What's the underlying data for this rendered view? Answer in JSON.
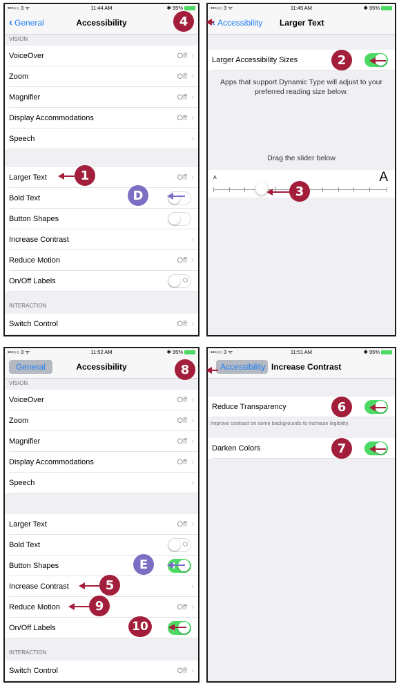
{
  "colors": {
    "accent": "#1a7cf5",
    "toggle_on": "#4cd964",
    "callout_red": "#a31e3a",
    "callout_purple": "#7b6fc4"
  },
  "panel1": {
    "status": {
      "signal": "•••○○ 3 ᯤ",
      "time": "11:44 AM",
      "battery": "✱ 95%"
    },
    "nav": {
      "back": "General",
      "title": "Accessibility"
    },
    "vision_header": "VISION",
    "rows": [
      {
        "label": "VoiceOver",
        "value": "Off"
      },
      {
        "label": "Zoom",
        "value": "Off"
      },
      {
        "label": "Magnifier",
        "value": "Off"
      },
      {
        "label": "Display Accommodations",
        "value": "Off"
      },
      {
        "label": "Speech",
        "value": ""
      }
    ],
    "rows2": [
      {
        "label": "Larger Text",
        "value": "Off"
      },
      {
        "label": "Bold Text"
      },
      {
        "label": "Button Shapes"
      },
      {
        "label": "Increase Contrast",
        "value": ""
      },
      {
        "label": "Reduce Motion",
        "value": "Off"
      },
      {
        "label": "On/Off Labels"
      }
    ],
    "interaction_header": "INTERACTION",
    "switch_control": {
      "label": "Switch Control",
      "value": "Off"
    },
    "callouts": {
      "one": "1",
      "d": "D"
    }
  },
  "panel2": {
    "status": {
      "signal": "•••○○ 3 ᯤ",
      "time": "11:45 AM",
      "battery": "✱ 95%"
    },
    "nav": {
      "back": "Accessibility",
      "title": "Larger Text"
    },
    "larger_sizes": "Larger Accessibility Sizes",
    "description": "Apps that support Dynamic Type will adjust to your preferred reading size below.",
    "drag_label": "Drag the slider below",
    "small_a": "A",
    "big_a": "A",
    "slider_position": 0.28,
    "callouts": {
      "two": "2",
      "three": "3",
      "four": "4"
    }
  },
  "panel3": {
    "status": {
      "signal": "•••○○ 3 ᯤ",
      "time": "11:52 AM",
      "battery": "✱ 95%"
    },
    "nav": {
      "back": "General",
      "title": "Accessibility"
    },
    "vision_header": "VISION",
    "rows": [
      {
        "label": "VoiceOver",
        "value": "Off"
      },
      {
        "label": "Zoom",
        "value": "Off"
      },
      {
        "label": "Magnifier",
        "value": "Off"
      },
      {
        "label": "Display Accommodations",
        "value": "Off"
      },
      {
        "label": "Speech",
        "value": ""
      }
    ],
    "rows2": [
      {
        "label": "Larger Text",
        "value": "Off"
      },
      {
        "label": "Bold Text"
      },
      {
        "label": "Button Shapes"
      },
      {
        "label": "Increase Contrast",
        "value": ""
      },
      {
        "label": "Reduce Motion",
        "value": "Off"
      },
      {
        "label": "On/Off Labels"
      }
    ],
    "interaction_header": "INTERACTION",
    "switch_control": {
      "label": "Switch Control",
      "value": "Off"
    },
    "callouts": {
      "e": "E",
      "five": "5",
      "nine": "9",
      "ten": "10"
    }
  },
  "panel4": {
    "status": {
      "signal": "•••○○ 3 ᯤ",
      "time": "11:51 AM",
      "battery": "✱ 95%"
    },
    "nav": {
      "back": "Accessibility",
      "title": "Increase Contrast"
    },
    "reduce_transparency": "Reduce Transparency",
    "footnote": "Improve contrast on some backgrounds to increase legibility.",
    "darken_colors": "Darken Colors",
    "callouts": {
      "six": "6",
      "seven": "7",
      "eight": "8"
    }
  }
}
